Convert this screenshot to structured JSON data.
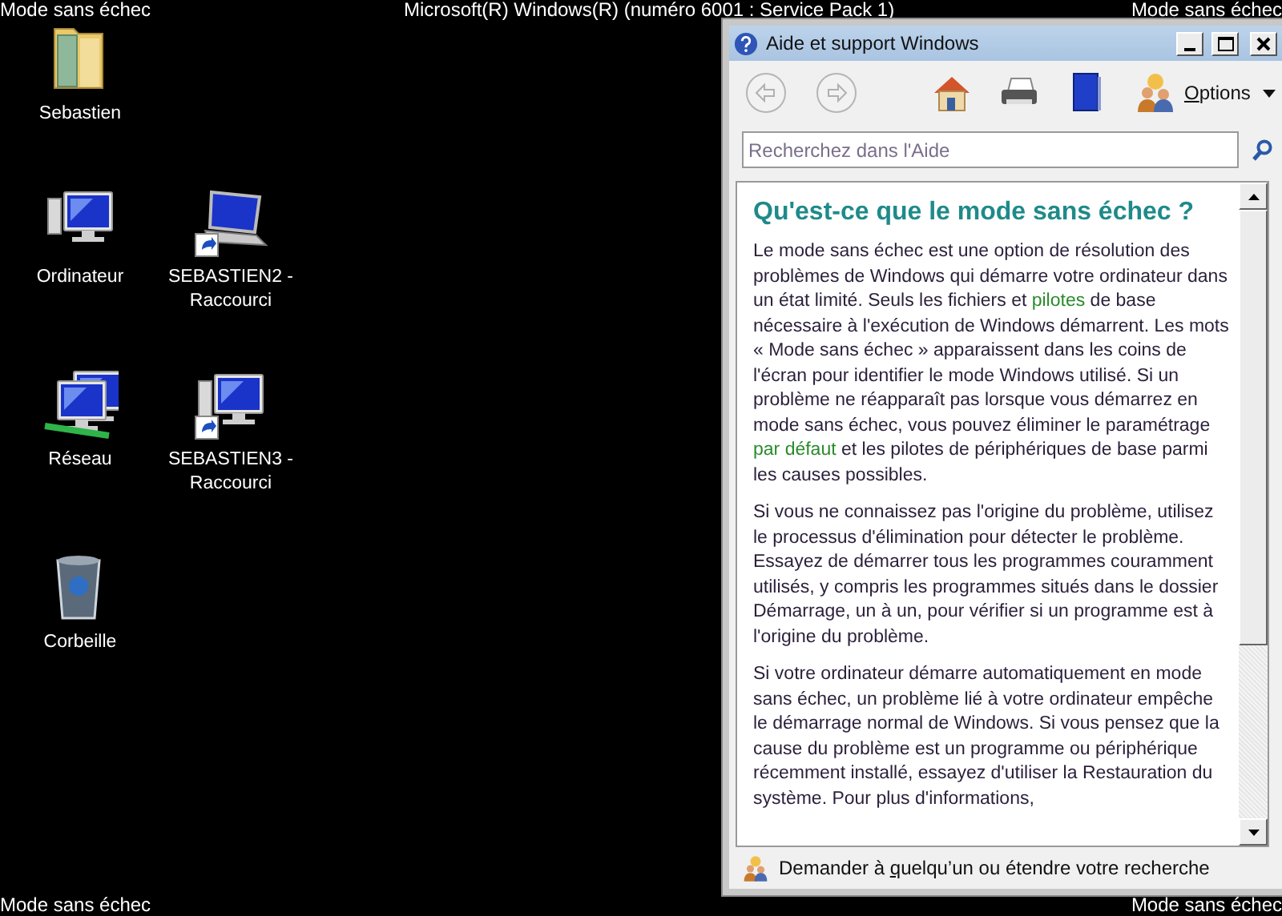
{
  "corner_labels": {
    "top_left": "Mode sans échec",
    "top_center": "Microsoft(R) Windows(R) (numéro 6001 : Service Pack 1)",
    "top_right": "Mode sans échec",
    "bottom_left": "Mode sans échec",
    "bottom_right": "Mode sans échec"
  },
  "desktop_icons": [
    {
      "label": "Sebastien",
      "kind": "user-folder",
      "shortcut": false
    },
    {
      "label": "Ordinateur",
      "kind": "computer",
      "shortcut": false
    },
    {
      "label": "SEBASTIEN2 - Raccourci",
      "kind": "laptop",
      "shortcut": true
    },
    {
      "label": "Réseau",
      "kind": "network",
      "shortcut": false
    },
    {
      "label": "SEBASTIEN3 - Raccourci",
      "kind": "computer",
      "shortcut": true
    },
    {
      "label": "Corbeille",
      "kind": "recycle-bin",
      "shortcut": false
    }
  ],
  "window": {
    "title": "Aide et support Windows",
    "toolbar": {
      "back_disabled": true,
      "forward_disabled": true,
      "options": [
        {
          "text": "O",
          "underlined": true
        },
        {
          "text": "ptions",
          "underlined": false
        }
      ]
    },
    "search": {
      "placeholder": "Recherchez dans l'Aide"
    },
    "article": {
      "heading": "Qu'est-ce que le mode sans échec ?",
      "paragraphs": [
        [
          {
            "kind": "text",
            "text": "Le mode sans échec est une option de résolution des problèmes de Windows qui démarre votre ordinateur dans un état limité. Seuls les fichiers et "
          },
          {
            "kind": "link",
            "text": "pilotes"
          },
          {
            "kind": "text",
            "text": " de base nécessaire à l'exécution de Windows démarrent. Les mots « Mode sans échec » apparaissent dans les coins de l'écran pour identifier le mode Windows utilisé. Si un problème ne réapparaît pas lorsque vous démarrez en mode sans échec, vous pouvez éliminer le paramétrage "
          },
          {
            "kind": "link",
            "text": "par défaut"
          },
          {
            "kind": "text",
            "text": " et les pilotes de périphériques de base parmi les causes possibles."
          }
        ],
        [
          {
            "kind": "text",
            "text": "Si vous ne connaissez pas l'origine du problème, utilisez le processus d'élimination pour détecter le problème. Essayez de démarrer tous les programmes couramment utilisés, y compris les programmes situés dans le dossier Démarrage, un à un, pour vérifier si un programme est à l'origine du problème."
          }
        ],
        [
          {
            "kind": "text",
            "text": "Si votre ordinateur démarre automatiquement en mode sans échec, un problème lié à votre ordinateur empêche le démarrage normal de Windows. Si vous pensez que la cause du problème est un programme ou périphérique récemment installé, essayez d'utiliser la Restauration du système. Pour plus d'informations,"
          }
        ]
      ]
    },
    "footer": [
      {
        "text": "Demander à ",
        "underlined": false
      },
      {
        "text": "q",
        "underlined": true
      },
      {
        "text": "uelqu’un ou étendre votre recherche",
        "underlined": false
      }
    ]
  }
}
